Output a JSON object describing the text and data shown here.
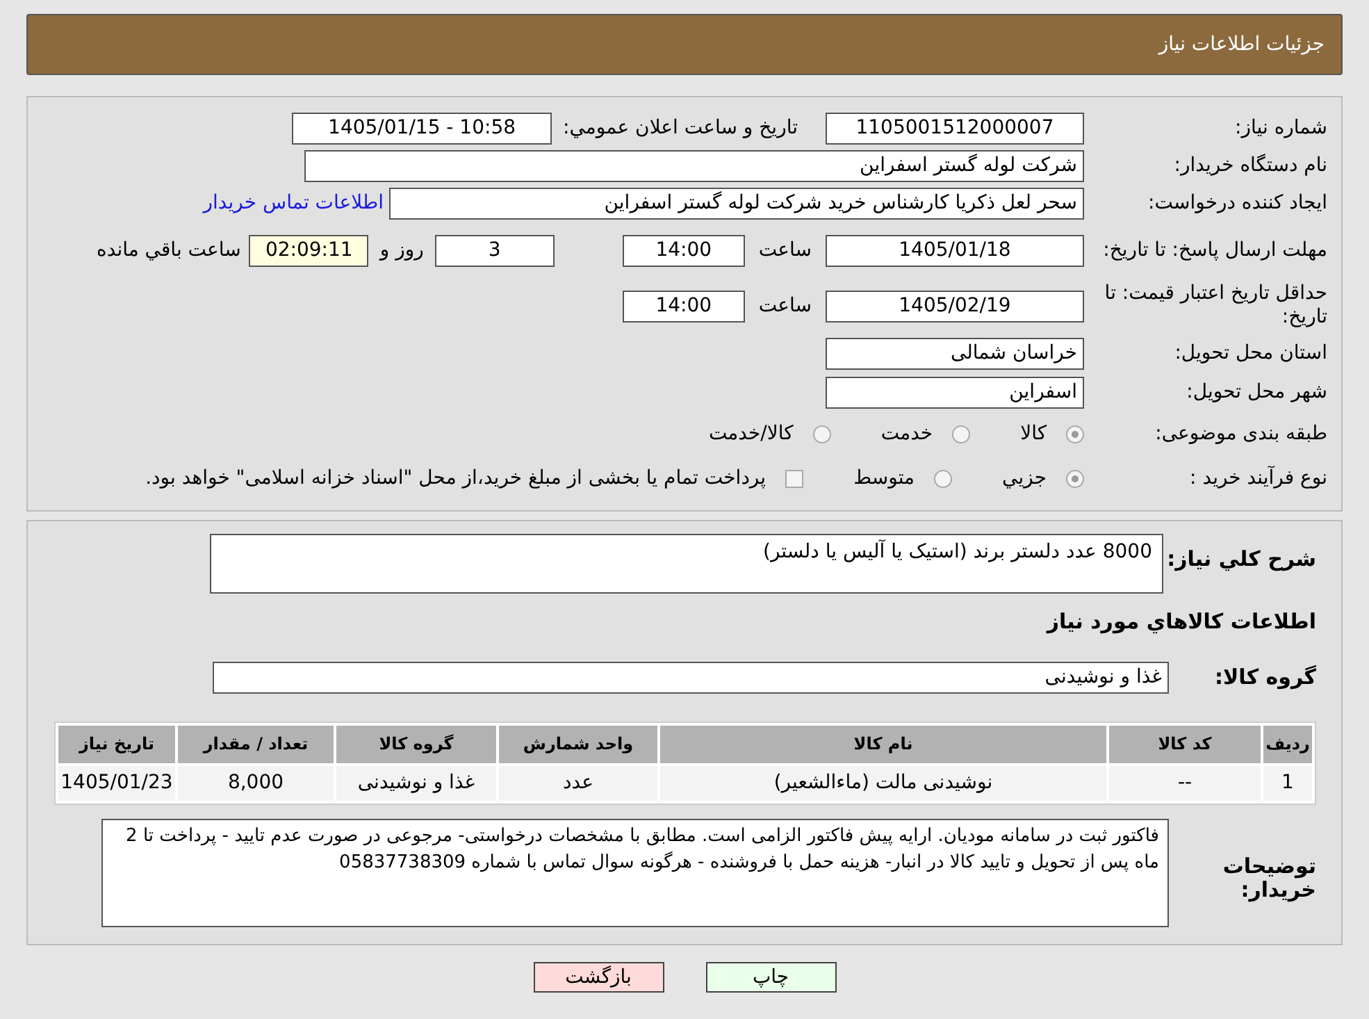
{
  "header": {
    "title": "جزئیات اطلاعات نیاز"
  },
  "need_number": {
    "label": "شماره نیاز:",
    "value": "1105001512000007"
  },
  "announce": {
    "label": "تاریخ و ساعت اعلان عمومي:",
    "value": "1405/01/15 - 10:58"
  },
  "buyer_org": {
    "label": "نام دستگاه خریدار:",
    "value": "شرکت لوله گستر اسفراین"
  },
  "creator": {
    "label": "ایجاد کننده درخواست:",
    "value": "سحر لعل ذکریا کارشناس خرید شرکت لوله گستر اسفراین",
    "link": "اطلاعات تماس خریدار"
  },
  "deadline": {
    "label": "مهلت ارسال پاسخ: تا تاریخ:",
    "date": "1405/01/18",
    "time_label": "ساعت",
    "time": "14:00",
    "days": "3",
    "days_label": "روز و",
    "remaining": "02:09:11",
    "remaining_label": "ساعت باقي مانده"
  },
  "validity": {
    "label": "حداقل تاریخ اعتبار قیمت: تا تاریخ:",
    "date": "1405/02/19",
    "time_label": "ساعت",
    "time": "14:00"
  },
  "province": {
    "label": "استان محل تحویل:",
    "value": "خراسان شمالی"
  },
  "city": {
    "label": "شهر محل تحویل:",
    "value": "اسفراین"
  },
  "category": {
    "label": "طبقه بندی موضوعی:",
    "options": [
      {
        "kind": "radio",
        "label": "کالا",
        "selected": true
      },
      {
        "kind": "radio",
        "label": "خدمت",
        "selected": false
      },
      {
        "kind": "radio",
        "label": "کالا/خدمت",
        "selected": false
      }
    ]
  },
  "process": {
    "label": "نوع فرآیند خرید :",
    "options": [
      {
        "kind": "radio",
        "label": "جزیي",
        "selected": true
      },
      {
        "kind": "radio",
        "label": "متوسط",
        "selected": false
      },
      {
        "kind": "checkbox",
        "label": "پرداخت تمام یا بخشی از مبلغ خرید،از محل \"اسناد خزانه اسلامی\" خواهد بود.",
        "checked": false
      }
    ]
  },
  "summary": {
    "label": "شرح کلي نیاز:",
    "value": "8000 عدد دلستر برند (استیک یا آلیس یا دلستر)"
  },
  "goods_heading": "اطلاعات کالاهاي مورد نیاز",
  "goods_group": {
    "label": "گروه کالا:",
    "value": "غذا و نوشیدنی"
  },
  "table": {
    "columns": [
      "ردیف",
      "کد کالا",
      "نام کالا",
      "واحد شمارش",
      "گروه کالا",
      "تعداد / مقدار",
      "تاریخ نیاز"
    ],
    "rows": [
      [
        "1",
        "--",
        "نوشیدنی مالت (ماءالشعیر)",
        "عدد",
        "غذا و نوشیدنی",
        "8,000",
        "1405/01/23"
      ]
    ]
  },
  "buyer_notes": {
    "label": "توضیحات خریدار:",
    "value": "فاکتور ثبت در سامانه مودیان. ارایه پیش فاکتور الزامی است. مطابق با مشخصات درخواستی- مرجوعی در صورت عدم تایید - پرداخت تا 2 ماه پس از تحویل و تایید کالا در انبار- هزینه حمل با فروشنده - هرگونه سوال تماس با شماره 05837738309"
  },
  "buttons": [
    {
      "kind": "print",
      "label": "چاپ"
    },
    {
      "kind": "back",
      "label": "بازگشت"
    }
  ]
}
